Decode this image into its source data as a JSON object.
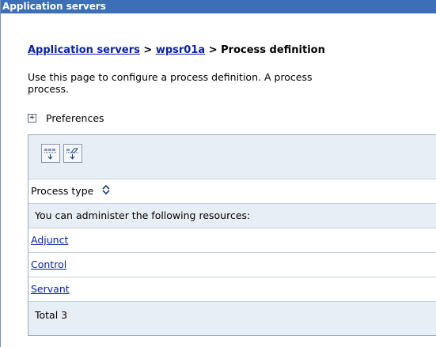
{
  "window": {
    "title": "Application servers"
  },
  "breadcrumb": {
    "items": [
      "Application servers",
      "wpsr01a"
    ],
    "separator": ">",
    "current": "Process definition"
  },
  "description": {
    "line1": "Use this page to configure a process definition. A process",
    "line2": "process."
  },
  "preferences": {
    "toggle": "+",
    "label": "Preferences"
  },
  "toolbar": {
    "icons": [
      "select-all-icon",
      "deselect-all-icon"
    ]
  },
  "table": {
    "column_header": "Process type",
    "sort_icon": "sort-arrows-icon",
    "subheader": "You can administer the following resources:",
    "rows": [
      "Adjunct",
      "Control",
      "Servant"
    ],
    "total": "Total 3"
  },
  "colors": {
    "title_bar": "#3c6fb5",
    "link": "#0a22a0",
    "table_band": "#e8eef5"
  }
}
